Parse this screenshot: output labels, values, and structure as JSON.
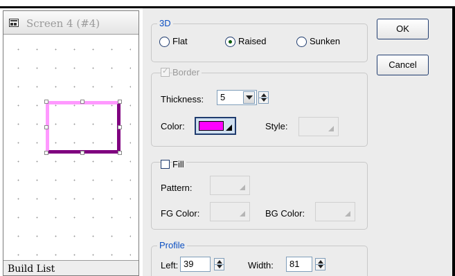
{
  "left_panel": {
    "title": "Screen 4 (#4)",
    "status": "Build List",
    "shape_colors": {
      "light": "#ff99ff",
      "dark": "#7f007f"
    }
  },
  "dialog": {
    "group_3d": {
      "title": "3D",
      "options": [
        {
          "label": "Flat",
          "checked": false
        },
        {
          "label": "Raised",
          "checked": true
        },
        {
          "label": "Sunken",
          "checked": false
        }
      ]
    },
    "ok_label": "OK",
    "cancel_label": "Cancel",
    "group_border": {
      "title": "Border",
      "checked": true,
      "disabled": true,
      "thickness_label": "Thickness:",
      "thickness_value": "5",
      "color_label": "Color:",
      "color_value": "#ff00ff",
      "style_label": "Style:"
    },
    "group_fill": {
      "title": "Fill",
      "checked": false,
      "pattern_label": "Pattern:",
      "fg_color_label": "FG Color:",
      "bg_color_label": "BG Color:"
    },
    "group_profile": {
      "title": "Profile",
      "left_label": "Left:",
      "left_value": "39",
      "width_label": "Width:",
      "width_value": "81"
    }
  },
  "icons": [
    "screen-icon",
    "dropdown-arrow-icon",
    "spinner-icon",
    "color-dropdown-icon"
  ]
}
